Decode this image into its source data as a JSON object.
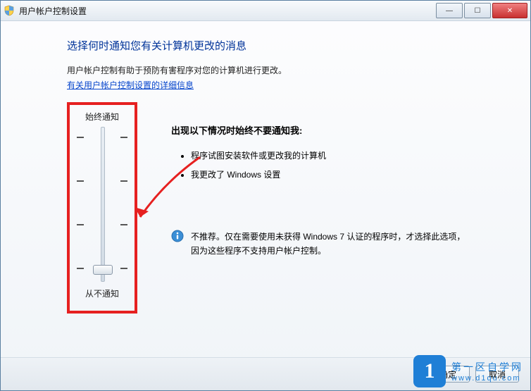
{
  "window": {
    "title": "用户帐户控制设置"
  },
  "page": {
    "heading": "选择何时通知您有关计算机更改的消息",
    "intro": "用户帐户控制有助于预防有害程序对您的计算机进行更改。",
    "link": "有关用户帐户控制设置的详细信息"
  },
  "slider": {
    "top_label": "始终通知",
    "bottom_label": "从不通知"
  },
  "panel": {
    "heading": "出现以下情况时始终不要通知我:",
    "bullet1": "程序试图安装软件或更改我的计算机",
    "bullet2": "我更改了 Windows 设置",
    "info": "不推荐。仅在需要使用未获得 Windows 7 认证的程序时，才选择此选项，因为这些程序不支持用户帐户控制。"
  },
  "buttons": {
    "ok": "确定",
    "cancel": "取消"
  },
  "watermark": {
    "line1": "第一区自学网",
    "line2": "www.d1qu.com"
  }
}
